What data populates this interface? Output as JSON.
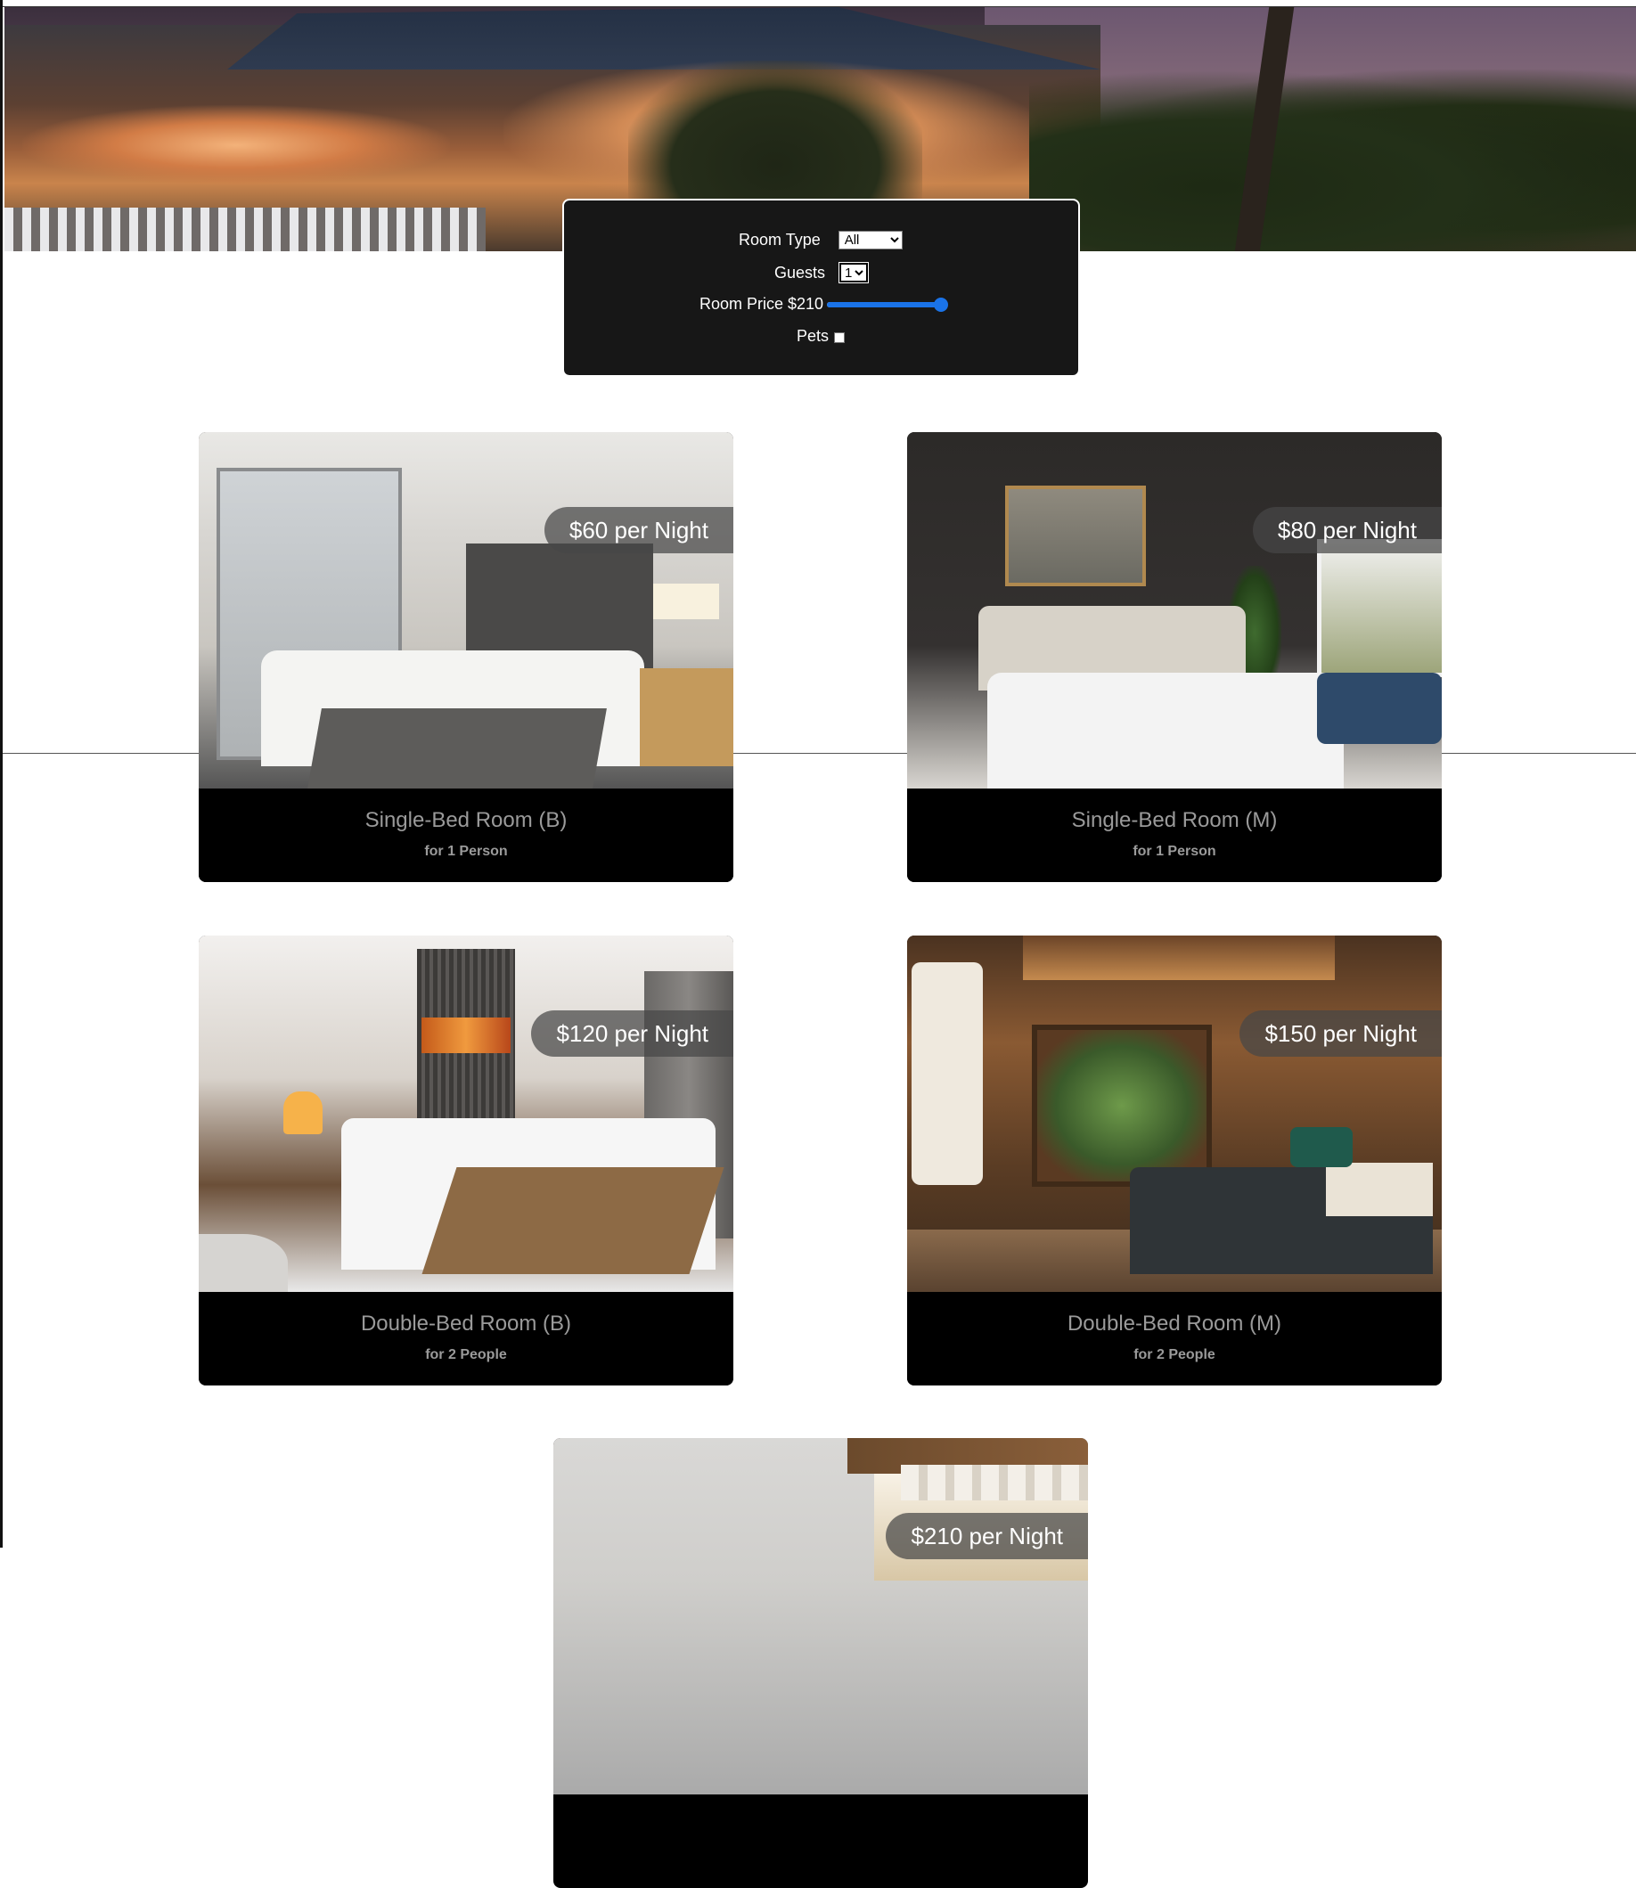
{
  "search": {
    "room_type_label": "Room Type",
    "room_type_selected": "All",
    "guests_label": "Guests",
    "guests_selected": "1",
    "price_label": "Room Price $210",
    "price_slider_fraction": 1.0,
    "pets_label": "Pets",
    "pets_checked": false,
    "accent_color": "#1a73e8"
  },
  "rooms": [
    {
      "price": "$60 per Night",
      "name": "Single-Bed Room (B)",
      "capacity": "for 1 Person"
    },
    {
      "price": "$80 per Night",
      "name": "Single-Bed Room (M)",
      "capacity": "for 1 Person"
    },
    {
      "price": "$120 per Night",
      "name": "Double-Bed Room (B)",
      "capacity": "for 2 People"
    },
    {
      "price": "$150 per Night",
      "name": "Double-Bed Room (M)",
      "capacity": "for 2 People"
    },
    {
      "price": "$210 per Night"
    }
  ]
}
